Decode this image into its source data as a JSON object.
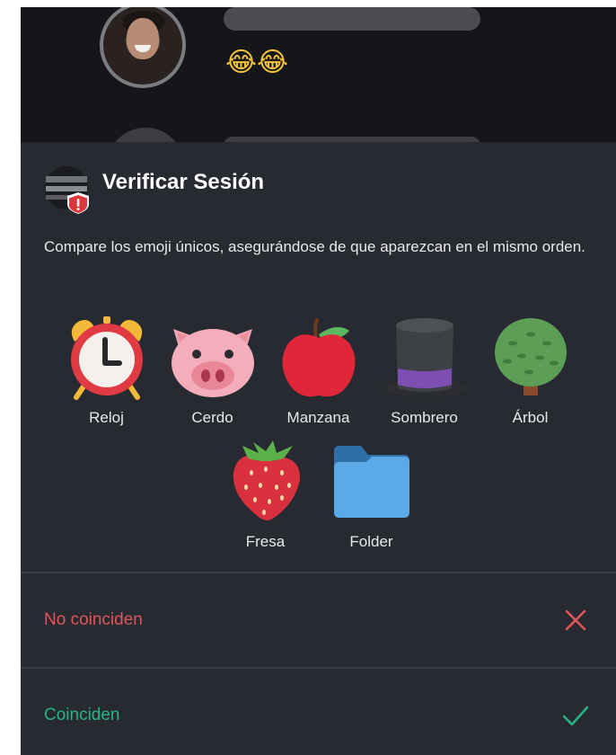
{
  "background_chat": {
    "message_emoji": "😂😂"
  },
  "sheet": {
    "title": "Verificar Sesión",
    "description": "Compare los emoji únicos, asegurándose de que aparezcan en el mismo orden.",
    "emojis": [
      {
        "label": "Reloj",
        "icon": "alarm-clock-icon"
      },
      {
        "label": "Cerdo",
        "icon": "pig-icon"
      },
      {
        "label": "Manzana",
        "icon": "apple-icon"
      },
      {
        "label": "Sombrero",
        "icon": "top-hat-icon"
      },
      {
        "label": "Árbol",
        "icon": "tree-icon"
      },
      {
        "label": "Fresa",
        "icon": "strawberry-icon"
      },
      {
        "label": "Folder",
        "icon": "folder-icon"
      }
    ],
    "actions": {
      "no_match": {
        "label": "No coinciden",
        "icon": "close-icon",
        "color": "#e0555b"
      },
      "match": {
        "label": "Coinciden",
        "icon": "check-icon",
        "color": "#27b48a"
      }
    }
  },
  "colors": {
    "sheet_background": "#272a31",
    "backdrop": "#15161a",
    "warning_badge": "#d9383d"
  }
}
